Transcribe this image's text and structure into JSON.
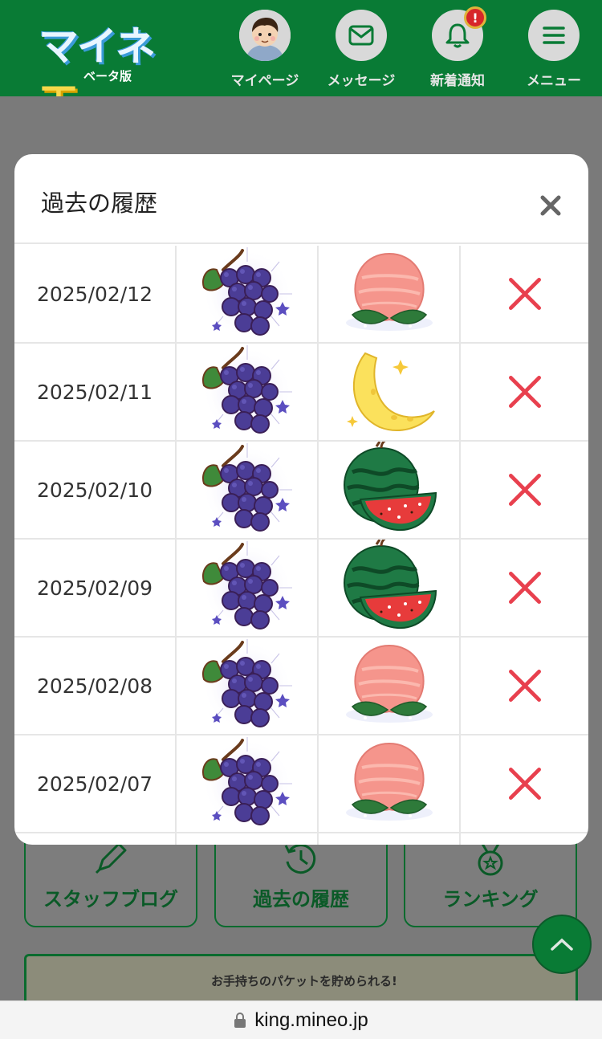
{
  "header": {
    "logo_text": "マイネ王",
    "logo_sub": "ベータ版",
    "nav": [
      {
        "label": "マイページ",
        "icon": "avatar-icon"
      },
      {
        "label": "メッセージ",
        "icon": "envelope-icon"
      },
      {
        "label": "新着通知",
        "icon": "bell-icon",
        "badge": "!"
      },
      {
        "label": "メニュー",
        "icon": "hamburger-icon"
      }
    ]
  },
  "background": {
    "buttons": [
      {
        "label": "スタッフブログ",
        "icon": "pen-icon"
      },
      {
        "label": "過去の履歴",
        "icon": "history-icon"
      },
      {
        "label": "ランキング",
        "icon": "medal-icon"
      }
    ],
    "banner_text": "お手持ちのパケットを貯められる!"
  },
  "modal": {
    "title": "過去の履歴",
    "close_label": "×",
    "rows": [
      {
        "date": "2025/02/12",
        "pick": "grape",
        "result": "peach",
        "mark": "miss"
      },
      {
        "date": "2025/02/11",
        "pick": "grape",
        "result": "banana",
        "mark": "miss"
      },
      {
        "date": "2025/02/10",
        "pick": "grape",
        "result": "watermelon",
        "mark": "miss"
      },
      {
        "date": "2025/02/09",
        "pick": "grape",
        "result": "watermelon",
        "mark": "miss"
      },
      {
        "date": "2025/02/08",
        "pick": "grape",
        "result": "peach",
        "mark": "miss"
      },
      {
        "date": "2025/02/07",
        "pick": "grape",
        "result": "peach",
        "mark": "miss"
      }
    ]
  },
  "urlbar": {
    "url": "king.mineo.jp",
    "icon": "lock-icon"
  },
  "colors": {
    "brand_green": "#097b35",
    "miss_red": "#e8404e"
  }
}
